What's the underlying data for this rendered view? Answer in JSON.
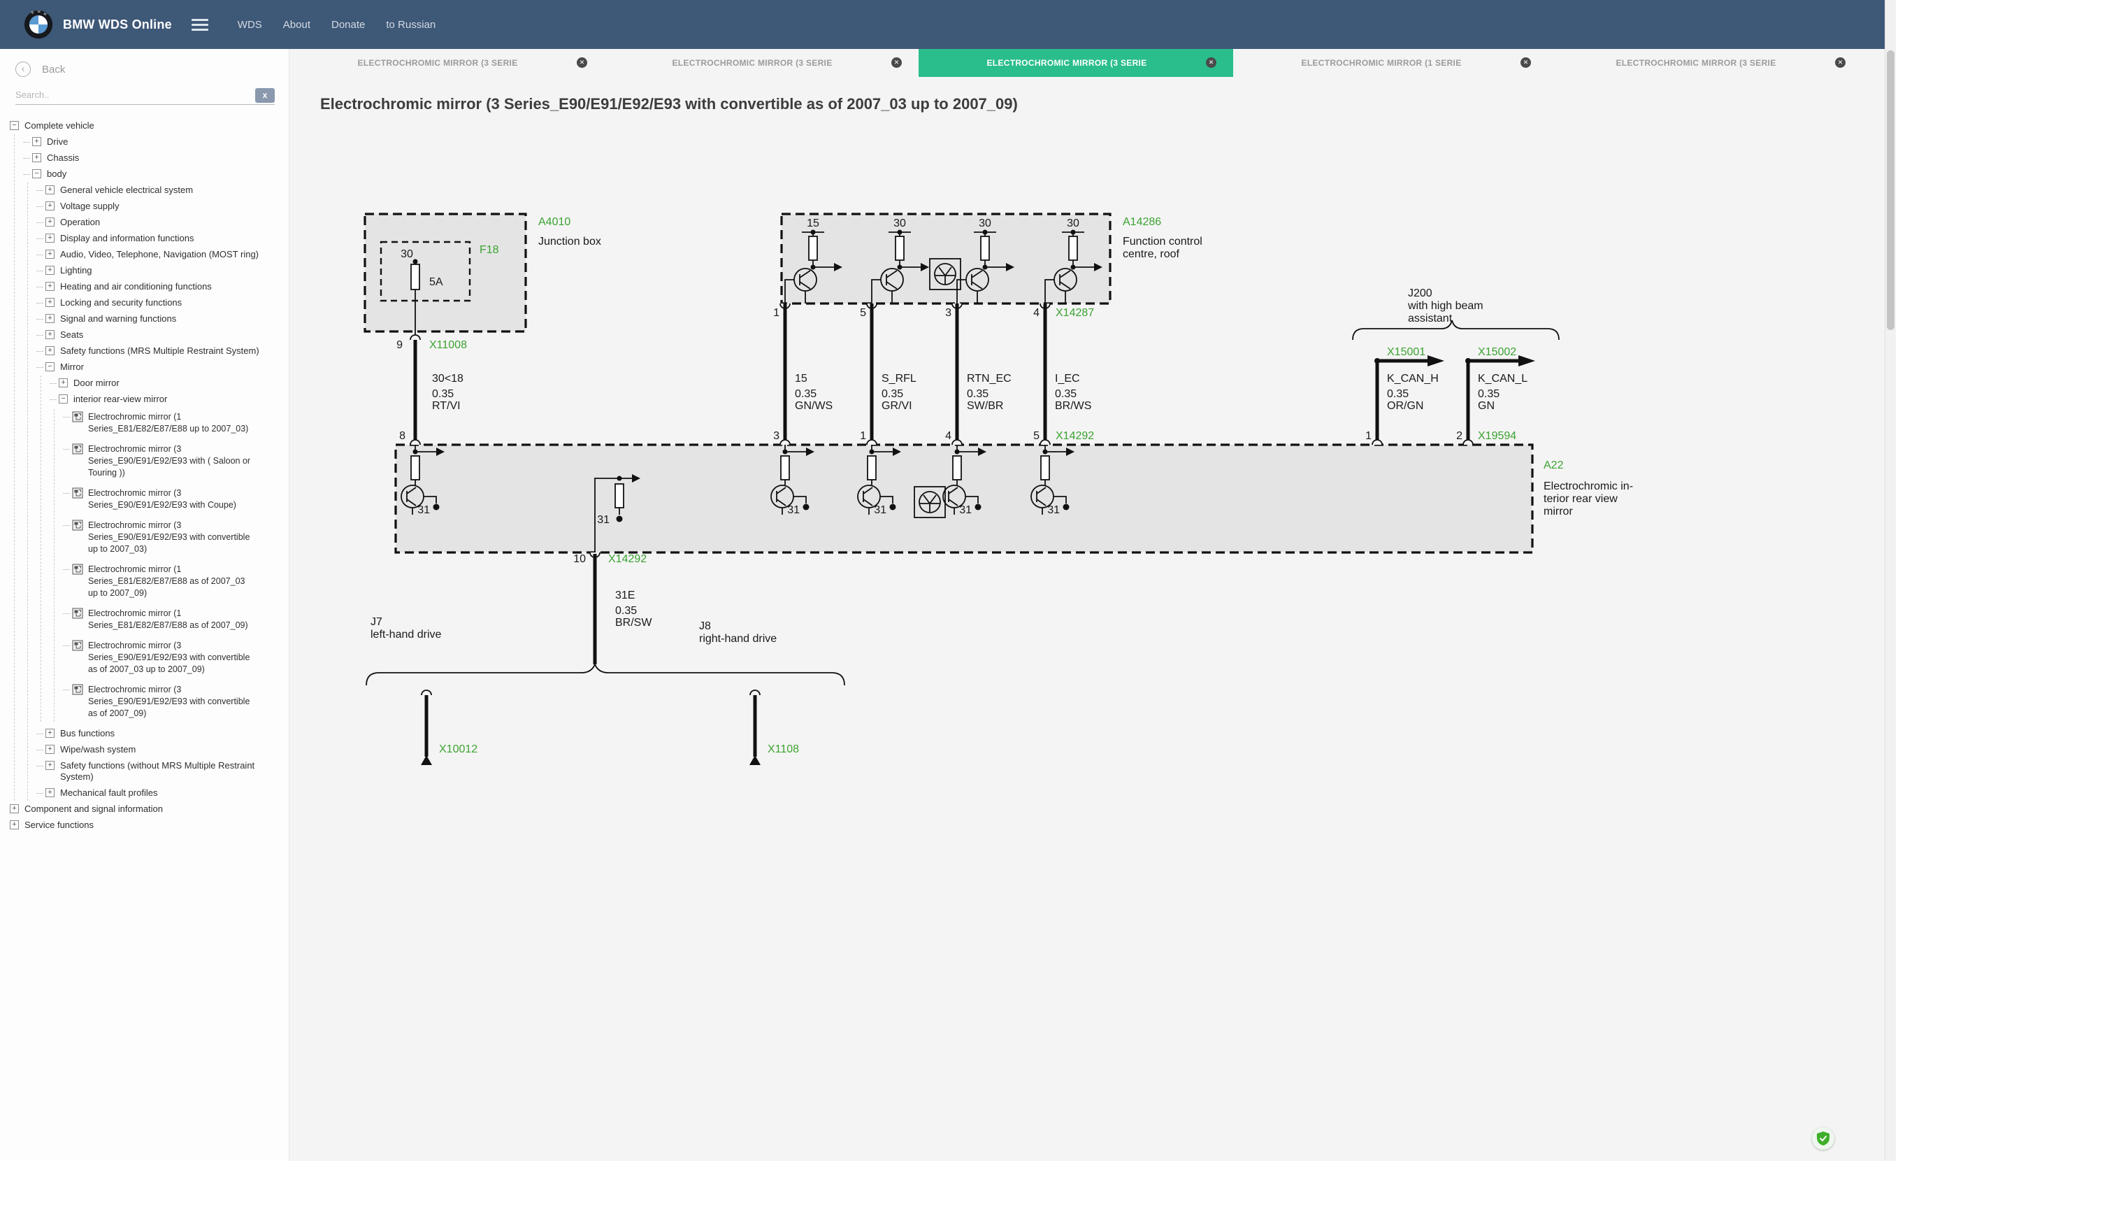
{
  "navbar": {
    "brand": "BMW WDS Online",
    "links": [
      "WDS",
      "About",
      "Donate",
      "to Russian"
    ]
  },
  "sidebar": {
    "back_label": "Back",
    "search_placeholder": "Search..",
    "clear_label": "x",
    "tree": [
      {
        "label": "Complete vehicle",
        "state": "open",
        "children": [
          {
            "label": "Drive",
            "state": "closed"
          },
          {
            "label": "Chassis",
            "state": "closed"
          },
          {
            "label": "body",
            "state": "open",
            "children": [
              {
                "label": "General vehicle electrical system",
                "state": "closed"
              },
              {
                "label": "Voltage supply",
                "state": "closed"
              },
              {
                "label": "Operation",
                "state": "closed"
              },
              {
                "label": "Display and information functions",
                "state": "closed"
              },
              {
                "label": "Audio, Video, Telephone, Navigation (MOST ring)",
                "state": "closed"
              },
              {
                "label": "Lighting",
                "state": "closed"
              },
              {
                "label": "Heating and air conditioning functions",
                "state": "closed"
              },
              {
                "label": "Locking and security functions",
                "state": "closed"
              },
              {
                "label": "Signal and warning functions",
                "state": "closed"
              },
              {
                "label": "Seats",
                "state": "closed"
              },
              {
                "label": "Safety functions (MRS Multiple Restraint System)",
                "state": "closed"
              },
              {
                "label": "Mirror",
                "state": "open",
                "children": [
                  {
                    "label": "Door mirror",
                    "state": "closed"
                  },
                  {
                    "label": "interior rear-view mirror",
                    "state": "open",
                    "children": [
                      {
                        "label": "Electrochromic mirror (1 Series_E81/E82/E87/E88 up to 2007_03)",
                        "state": "leaf"
                      },
                      {
                        "label": "Electrochromic mirror (3 Series_E90/E91/E92/E93 with ( Saloon or Touring ))",
                        "state": "leaf"
                      },
                      {
                        "label": "Electrochromic mirror (3 Series_E90/E91/E92/E93 with Coupe)",
                        "state": "leaf"
                      },
                      {
                        "label": "Electrochromic mirror (3 Series_E90/E91/E92/E93 with convertible up to 2007_03)",
                        "state": "leaf"
                      },
                      {
                        "label": "Electrochromic mirror (1 Series_E81/E82/E87/E88 as of 2007_03 up to 2007_09)",
                        "state": "leaf"
                      },
                      {
                        "label": "Electrochromic mirror (1 Series_E81/E82/E87/E88 as of 2007_09)",
                        "state": "leaf"
                      },
                      {
                        "label": "Electrochromic mirror (3 Series_E90/E91/E92/E93 with convertible as of 2007_03 up to 2007_09)",
                        "state": "leaf"
                      },
                      {
                        "label": "Electrochromic mirror (3 Series_E90/E91/E92/E93 with convertible as of 2007_09)",
                        "state": "leaf"
                      }
                    ]
                  }
                ]
              },
              {
                "label": "Bus functions",
                "state": "closed"
              },
              {
                "label": "Wipe/wash system",
                "state": "closed"
              },
              {
                "label": "Safety functions (without MRS Multiple Restraint System)",
                "state": "closed"
              },
              {
                "label": "Mechanical fault profiles",
                "state": "closed"
              }
            ]
          }
        ]
      },
      {
        "label": "Component and signal information",
        "state": "closed"
      },
      {
        "label": "Service functions",
        "state": "closed"
      }
    ]
  },
  "tabs": [
    {
      "label": "ELECTROCHROMIC MIRROR (3 SERIE",
      "active": false
    },
    {
      "label": "ELECTROCHROMIC MIRROR (3 SERIE",
      "active": false
    },
    {
      "label": "ELECTROCHROMIC MIRROR (3 SERIE",
      "active": true
    },
    {
      "label": "ELECTROCHROMIC MIRROR (1 SERIE",
      "active": false
    },
    {
      "label": "ELECTROCHROMIC MIRROR (3 SERIE",
      "active": false
    }
  ],
  "page": {
    "title": "Electrochromic mirror (3 Series_E90/E91/E92/E93 with convertible as of 2007_03 up to 2007_09)"
  },
  "colors": {
    "navbar_blue": "#3e5877",
    "tab_active_green": "#2abe8c",
    "diagram_label_green": "#3ba331",
    "component_fill": "#e4e4e4"
  },
  "diagram": {
    "a4010": {
      "id": "A4010",
      "name": "Junction box",
      "fuse_id": "F18",
      "fuse_terminal": "30",
      "fuse_rating": "5A",
      "pin_out": "9",
      "connector_out": "X11008"
    },
    "main_wire": {
      "name": "30<18",
      "gauge": "0.35",
      "color": "RT/VI",
      "pin_a22": "8"
    },
    "a14286": {
      "id": "A14286",
      "name1": "Function control",
      "name2": "centre, roof",
      "terminals": [
        "15",
        "30",
        "30",
        "30"
      ],
      "pins": [
        "1",
        "5",
        "3",
        "4"
      ],
      "connector": "X14287"
    },
    "wires": [
      {
        "name": "15",
        "gauge": "0.35",
        "color": "GN/WS",
        "pin_a22": "3"
      },
      {
        "name": "S_RFL",
        "gauge": "0.35",
        "color": "GR/VI",
        "pin_a22": "1"
      },
      {
        "name": "RTN_EC",
        "gauge": "0.35",
        "color": "SW/BR",
        "pin_a22": "4"
      },
      {
        "name": "I_EC",
        "gauge": "0.35",
        "color": "BR/WS",
        "pin_a22": "5"
      }
    ],
    "connector_a22_top": "X14292",
    "j200": {
      "lines": [
        "J200",
        "with high beam",
        "assistant"
      ],
      "x15001": "X15001",
      "x15002": "X15002",
      "can_h": {
        "name": "K_CAN_H",
        "gauge": "0.35",
        "color": "OR/GN",
        "pin": "1"
      },
      "can_l": {
        "name": "K_CAN_L",
        "gauge": "0.35",
        "color": "GN",
        "pin": "2"
      },
      "connector": "X19594"
    },
    "a22": {
      "id": "A22",
      "name_lines": [
        "Electrochromic in-",
        "terior rear view",
        "mirror"
      ],
      "ground": "31",
      "pin_bottom": "10",
      "connector_bottom": "X14292"
    },
    "ground_wire": {
      "name": "31E",
      "gauge": "0.35",
      "color": "BR/SW"
    },
    "j7": {
      "id": "J7",
      "name": "left-hand drive",
      "connector": "X10012"
    },
    "j8": {
      "id": "J8",
      "name": "right-hand drive",
      "connector": "X1108"
    }
  }
}
